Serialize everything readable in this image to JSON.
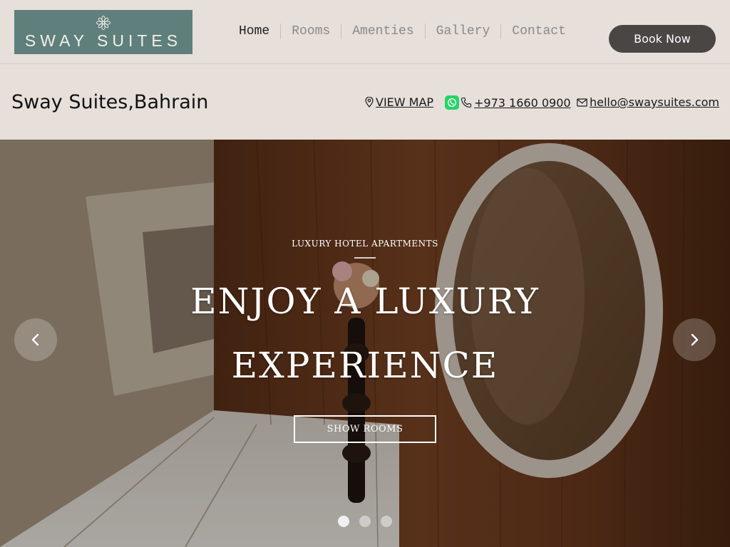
{
  "brand": {
    "name": "SWAY SUITES",
    "bg_color": "#5f7f7c"
  },
  "nav": {
    "items": [
      "Home",
      "Rooms",
      "Amenties",
      "Gallery",
      "Contact"
    ],
    "active": "Home"
  },
  "header": {
    "book_label": "Book Now"
  },
  "info": {
    "title": "Sway Suites,Bahrain",
    "map_label": "VIEW MAP",
    "phone": "+973 1660 0900",
    "email": "hello@swaysuites.com"
  },
  "hero": {
    "eyebrow": "LUXURY HOTEL APARTMENTS",
    "headline_line1": "ENJOY A LUXURY",
    "headline_line2": "EXPERIENCE",
    "cta_label": "SHOW ROOMS",
    "slide_count": 3,
    "active_slide": 1
  },
  "icons": {
    "logo": "flower-icon",
    "map": "map-pin-icon",
    "whatsapp": "whatsapp-icon",
    "phone": "phone-icon",
    "mail": "mail-icon",
    "prev": "chevron-left-icon",
    "next": "chevron-right-icon"
  },
  "colors": {
    "page_bg": "#e6dfda",
    "button_dark": "#4a4644",
    "whatsapp": "#25d366"
  }
}
